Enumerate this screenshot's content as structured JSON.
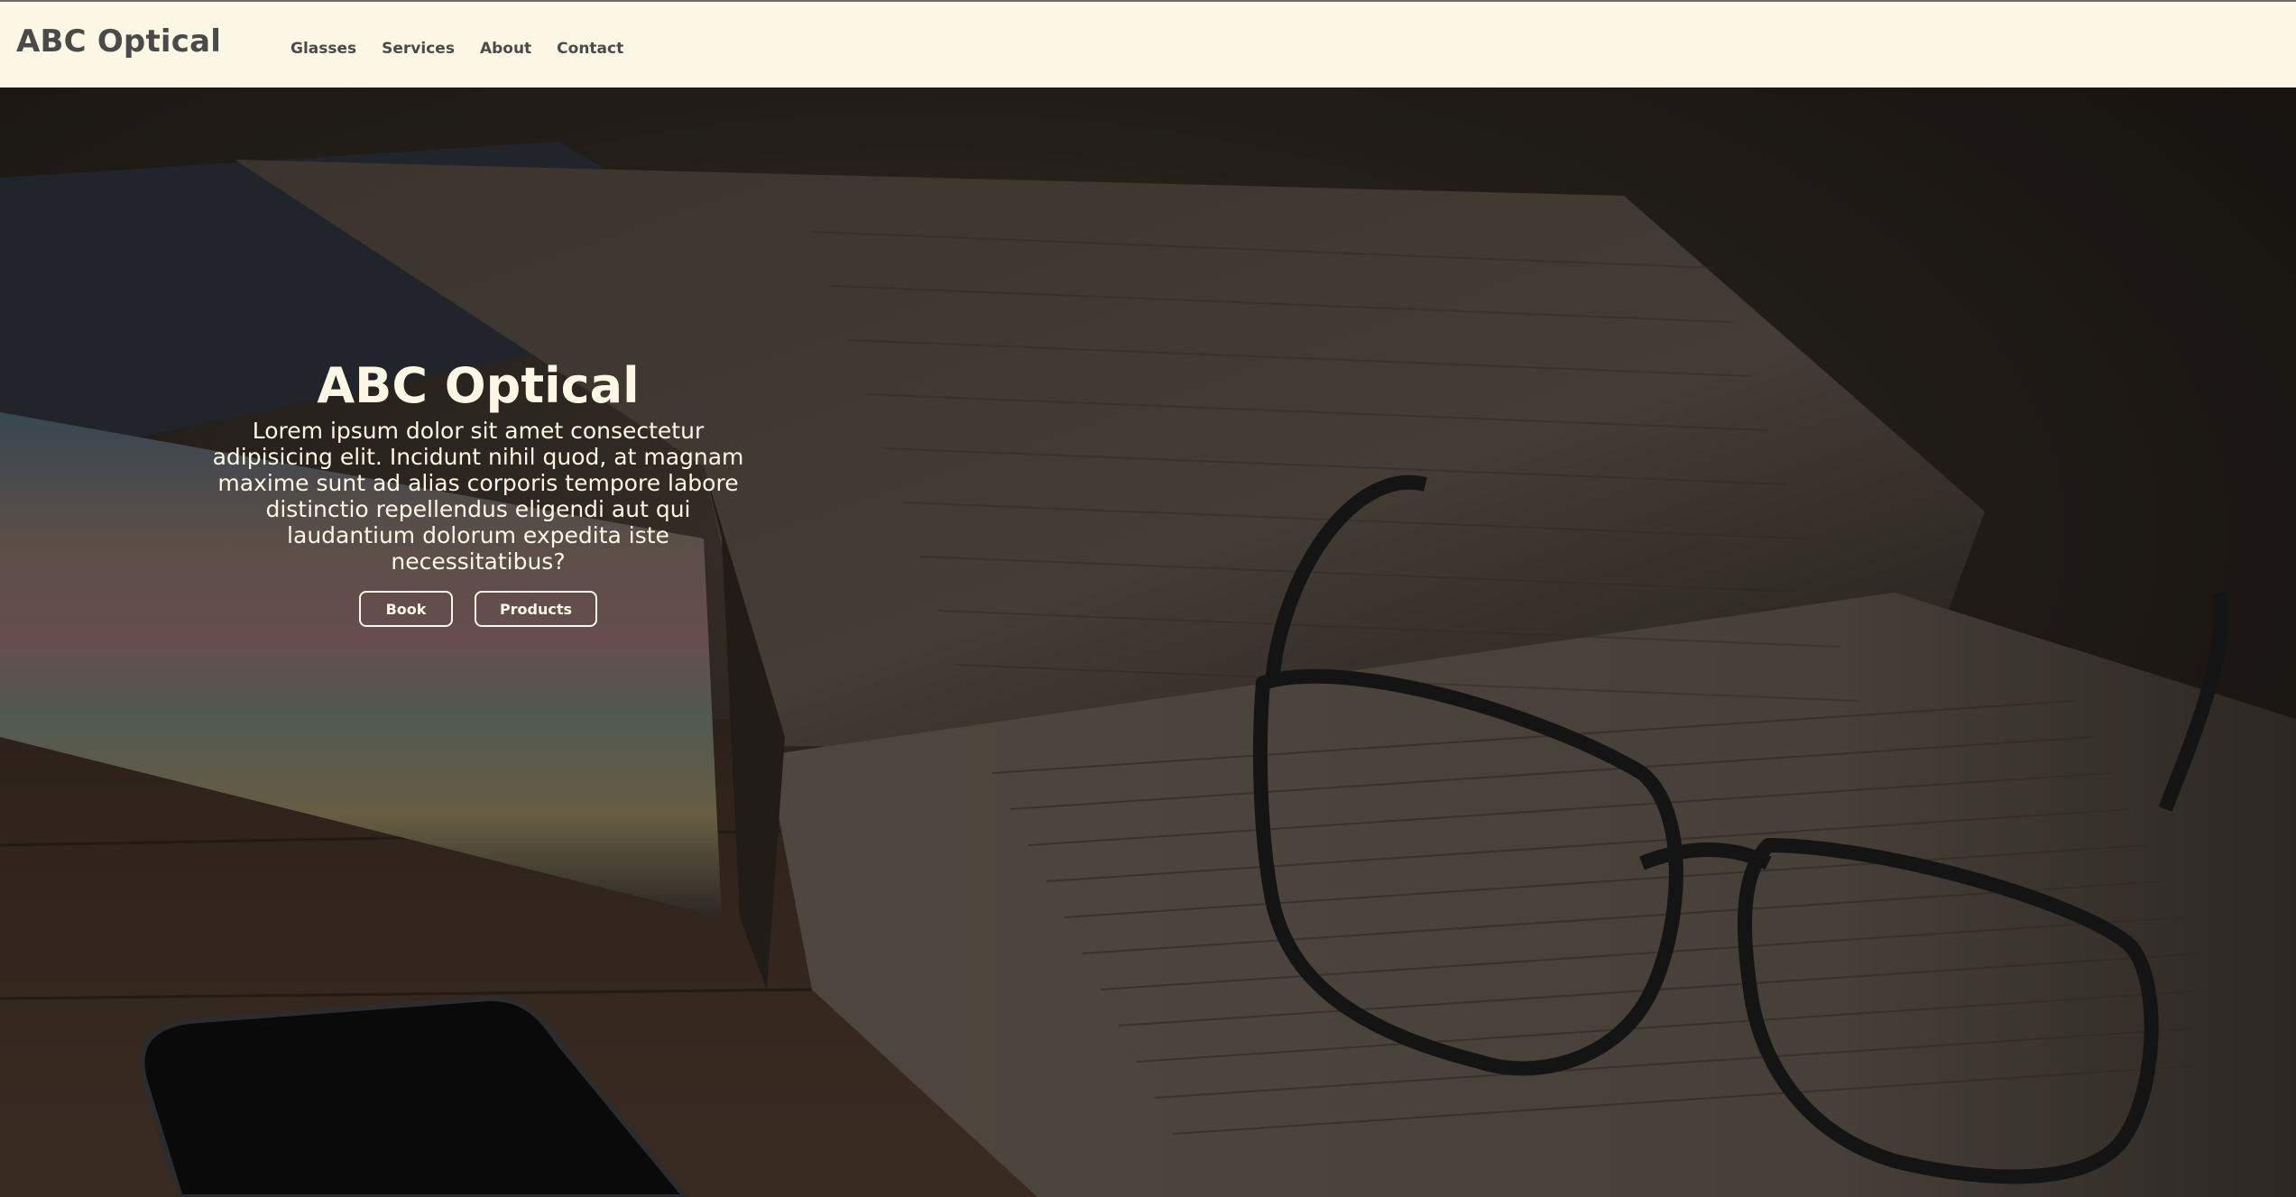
{
  "navbar": {
    "brand": "ABC Optical",
    "links": [
      "Glasses",
      "Services",
      "About",
      "Contact"
    ]
  },
  "hero": {
    "title": "ABC Optical",
    "text": "Lorem ipsum dolor sit amet consectetur adipisicing elit. Incidunt nihil quod, at magnam maxime sunt ad alias corporis tempore labore distinctio repellendus eligendi aut qui laudantium dolorum expedita iste necessitatibus?",
    "buttons": {
      "book": "Book",
      "products": "Products"
    },
    "background_image": "eyeglasses-on-open-book"
  },
  "colors": {
    "navbar_bg": "#fdf8e6",
    "brand_text": "#4a4a4a",
    "hero_text": "#fdf8e6"
  }
}
